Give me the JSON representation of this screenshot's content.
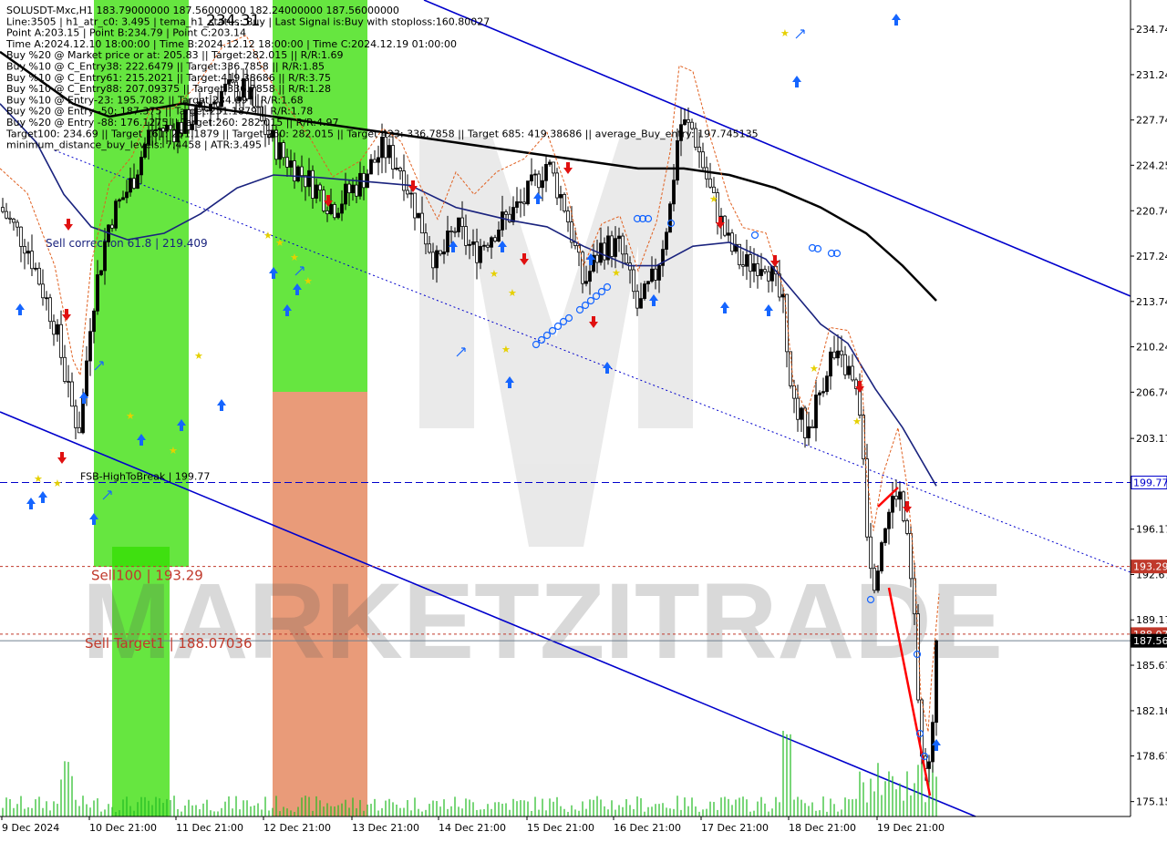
{
  "chart_data": {
    "type": "candlestick",
    "symbol": "SOLUSDT-Mxc,H1",
    "ohlc": [
      183.79,
      187.56,
      182.24,
      187.56
    ],
    "ylim": [
      174.0,
      237.0
    ],
    "x_range": [
      0,
      1237
    ],
    "y_ticks": [
      "234.74",
      "231.24",
      "227.74",
      "224.25",
      "220.74",
      "217.24",
      "213.74",
      "210.24",
      "206.74",
      "203.17",
      "199.7",
      "196.17",
      "192.67",
      "189.17",
      "185.67",
      "182.16",
      "178.67",
      "175.15"
    ],
    "x_ticks": [
      "9 Dec 2024",
      "10 Dec 21:00",
      "11 Dec 21:00",
      "12 Dec 21:00",
      "13 Dec 21:00",
      "14 Dec 21:00",
      "15 Dec 21:00",
      "16 Dec 21:00",
      "17 Dec 21:00",
      "18 Dec 21:00",
      "19 Dec 21:00"
    ],
    "info_lines": [
      "SOLUSDT-Mxc,H1  183.79000000 187.56000000 182.24000000 187.56000000",
      "Line:3505 | h1_atr_c0: 3.495 | tema_h1_status: Buy | Last Signal is:Buy with stoploss:160.80027",
      "Point A:203.15 | Point B:234.79 | Point C:203.14",
      "Time A:2024.12.10 18:00:00 | Time B:2024.12.12 18:00:00 | Time C:2024.12.19 01:00:00",
      "Buy %20 @ Market price or at: 205.83 || Target:282.015 || R/R:1.69",
      "Buy %10 @ C_Entry38: 222.6479 || Target:336.7858 || R/R:1.85",
      "Buy %10 @ C_Entry61: 215.2021 || Target:419.38686 || R/R:3.75",
      "Buy %10 @ C_Entry88: 207.09375 || Target:336.7858 || R/R:1.28",
      "Buy %10 @ Entry-23: 195.7082 || Target:234.69 || R/R:1.68",
      "Buy %20 @ Entry -50: 187.375 || Target:251.1879 || R/R:1.78",
      "Buy %20 @ Entry -88: 176.1275 || Target:260: 282.015 || R/R:4.97",
      "Target100: 234.69 || Target 161: 251.1879 || Target 260: 282.015 || Target 423: 336.7858 || Target 685: 419.38686 || average_Buy_entry: 197.745135",
      "minimum_distance_buy_levels: 7.4458 | ATR:3.495"
    ],
    "levels": [
      {
        "name": "FSB-HighToBreak",
        "value": 199.77,
        "label": "FSB-HighToBreak | 199.77",
        "tag": "199.77",
        "color": "#0000cc"
      },
      {
        "name": "Sell100",
        "value": 193.29,
        "label": "Sell100 | 193.29",
        "tag": "193.29",
        "color": "#c0392b"
      },
      {
        "name": "Sell Target1",
        "value": 188.07,
        "label": "Sell Target1 | 188.07036",
        "tag": "188.07",
        "color": "#c0392b"
      },
      {
        "name": "current",
        "value": 187.56,
        "label": "",
        "tag": "187.56",
        "color": "#000000"
      }
    ],
    "annotations": {
      "sell_correction": "Sell correction 61.8 | 219.409",
      "top_marker": "234.31"
    },
    "watermark": "MARKETZITRADE",
    "colors": {
      "bull": "#000000",
      "bear": "#000000",
      "channel": "#0000cc",
      "ma_long": "#000000",
      "ma_short": "#1a237e",
      "zone_green": "#33dd00",
      "zone_orange": "#e07040",
      "arrow_up": "#1565ff",
      "arrow_down": "#e01010"
    }
  }
}
